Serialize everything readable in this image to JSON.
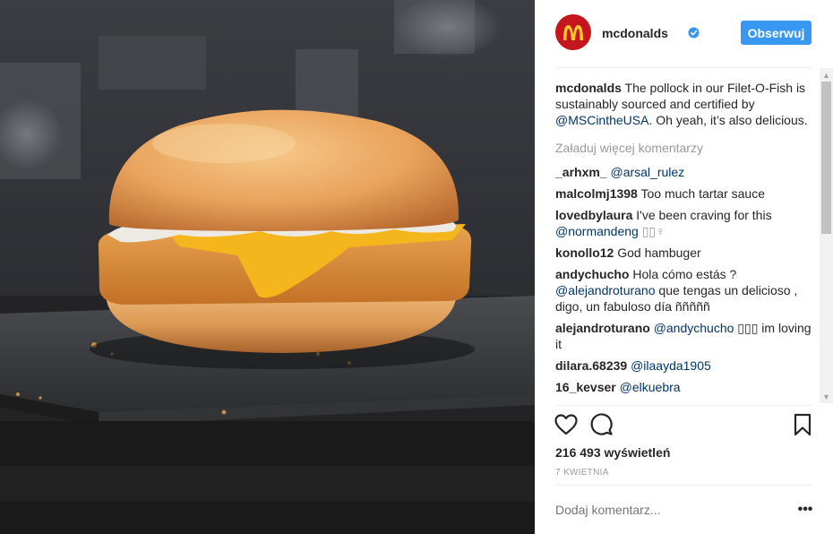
{
  "header": {
    "username": "mcdonalds",
    "follow_label": "Obserwuj"
  },
  "caption": {
    "username": "mcdonalds",
    "text_before": "The pollock in our Filet-O-Fish is sustainably sourced and certified by ",
    "mention": "@MSCintheUSA",
    "text_after": ". Oh yeah, it’s also delicious."
  },
  "load_more_label": "Załaduj więcej komentarzy",
  "comments": [
    {
      "user": "_arhxm_",
      "mention": "@arsal_rulez",
      "text": ""
    },
    {
      "user": "malcolmj1398",
      "mention": "",
      "text": "Too much tartar sauce"
    },
    {
      "user": "lovedbylaura",
      "mention": "",
      "text": "I've been craving for this",
      "mention2": "@normandeng",
      "text2": "▯▯♀"
    },
    {
      "user": "konollo12",
      "mention": "",
      "text": "God hambuger"
    },
    {
      "user": "andychucho",
      "mention": "",
      "text": "Hola cómo estás ?",
      "mention2": "@alejandroturano",
      "text2": "que tengas un delicioso , digo, un fabuloso día ñññññ"
    },
    {
      "user": "alejandroturano",
      "mention": "@andychucho",
      "text": "▯▯▯ im loving it"
    },
    {
      "user": "dilara.68239",
      "mention": "@ilaayda1905",
      "text": ""
    },
    {
      "user": "16_kevser",
      "mention": "@elkuebra",
      "text": ""
    }
  ],
  "views_text": "216 493 wyświetleń",
  "date_text": "7 KWIETNIA",
  "add_comment_placeholder": "Dodaj komentarz...",
  "more_label": "•••",
  "icons": {
    "avatar": "mcdonalds-logo-icon",
    "verified": "verified-badge-icon",
    "like": "heart-icon",
    "comment": "comment-bubble-icon",
    "save": "bookmark-icon"
  },
  "colors": {
    "brand_red": "#c4161c",
    "logo_yellow": "#ffc72c",
    "follow_blue": "#3897f0",
    "mention_blue": "#003569"
  }
}
